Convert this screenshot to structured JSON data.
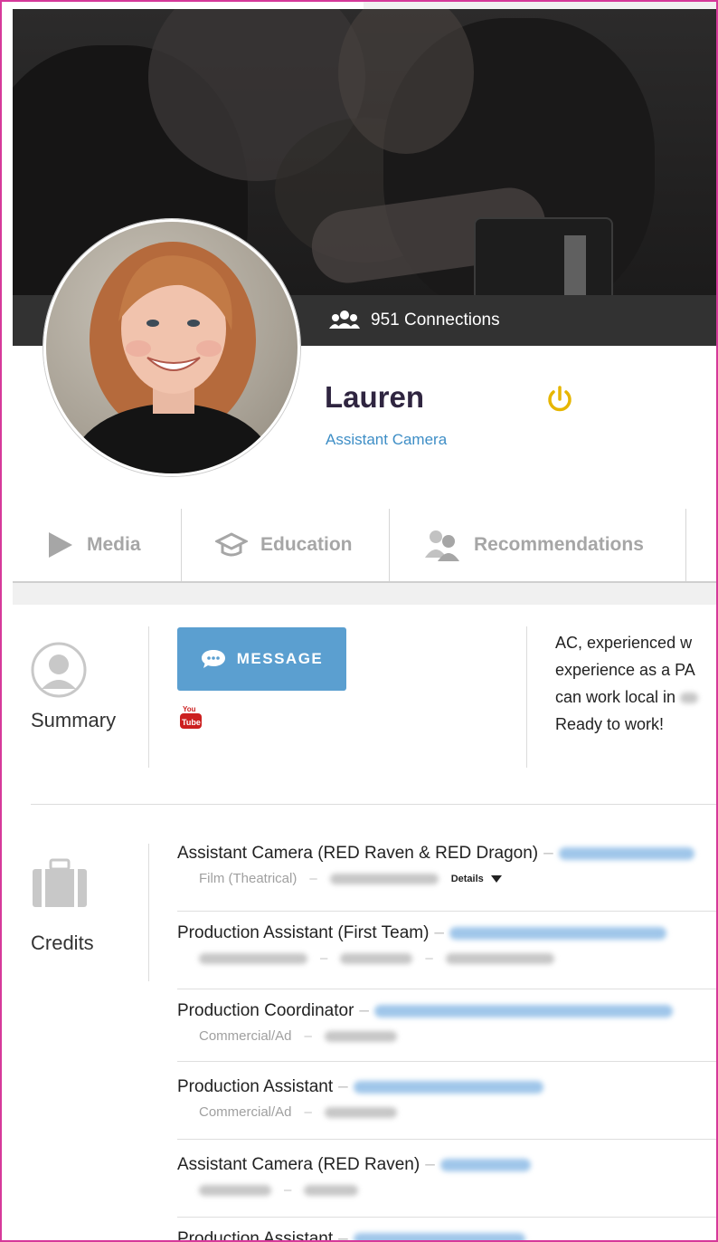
{
  "profile": {
    "name": "Lauren",
    "role": "Assistant Camera",
    "connections": "951 Connections"
  },
  "tabs": [
    {
      "label": "Media",
      "icon": "play-icon"
    },
    {
      "label": "Education",
      "icon": "graduation-cap-icon"
    },
    {
      "label": "Recommendations",
      "icon": "people-icon"
    }
  ],
  "summary": {
    "label": "Summary",
    "message_button": "MESSAGE",
    "youtube_icon": "youtube-icon",
    "text_lines": [
      "AC, experienced w",
      "experience as a PA",
      "can work local in",
      "Ready to work!"
    ]
  },
  "credits": {
    "label": "Credits",
    "details_label": "Details",
    "items": [
      {
        "title": "Assistant Camera (RED Raven & RED Dragon)",
        "sub": "Film (Theatrical)"
      },
      {
        "title": "Production Assistant (First Team)",
        "sub": ""
      },
      {
        "title": "Production Coordinator",
        "sub": "Commercial/Ad"
      },
      {
        "title": "Production Assistant",
        "sub": "Commercial/Ad"
      },
      {
        "title": "Assistant Camera (RED Raven)",
        "sub": ""
      },
      {
        "title": "Production Assistant",
        "sub": ""
      }
    ]
  },
  "colors": {
    "accent_blue": "#5b9fd0",
    "link_blue": "#3e8ec6",
    "name_color": "#2f2540",
    "power_icon": "#e6b600",
    "youtube_red": "#cc1f1f",
    "frame_border": "#d6399a"
  }
}
